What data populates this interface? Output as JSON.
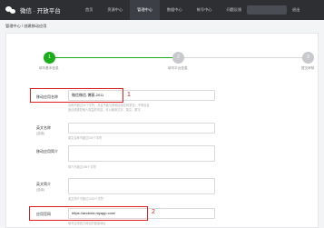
{
  "topbar": {
    "title": "微信 · 开放平台",
    "nav": [
      "首页",
      "资源中心",
      "管理中心",
      "数据中心",
      "帐号中心",
      "问题反馈"
    ],
    "active_index": 2,
    "account": "",
    "logout": "退出"
  },
  "breadcrumb": "管理中心 / 创建移动应用",
  "steps": [
    {
      "number": "1",
      "label": "填写基本信息",
      "status": "done"
    },
    {
      "number": "2",
      "label": "填写平台信息",
      "status": "todo"
    },
    {
      "number": "3",
      "label": "提交审核",
      "status": "todo"
    }
  ],
  "form": {
    "app_name": {
      "label": "移动应用名称",
      "value": "微信微信-博客-2011",
      "hint": "名称不超过32个字符，并且不能与其他应用名称重复；不得包含 违法或侵犯他人权益的内容，可以使用汉字、英文、数字"
    },
    "app_name_en": {
      "label": "英文名称",
      "sub": "(选填)",
      "value": "",
      "hint": "英文名称不超过100个字符"
    },
    "app_intro": {
      "label": "移动应用简介",
      "value": "",
      "hint": "简介不超过256个字符"
    },
    "app_intro_en": {
      "label": "英文简介",
      "sub": "(选填)",
      "value": "",
      "hint": "英文简介不超过1000个字符"
    },
    "website": {
      "label": "应用官网",
      "value": "https://android.myapp.com/",
      "hint": "填写应用官方网站的链接地址"
    }
  },
  "annotations": [
    "1",
    "2"
  ],
  "colors": {
    "accent": "#1aad19",
    "highlight": "#e02020",
    "topbar": "#2d2f33"
  }
}
